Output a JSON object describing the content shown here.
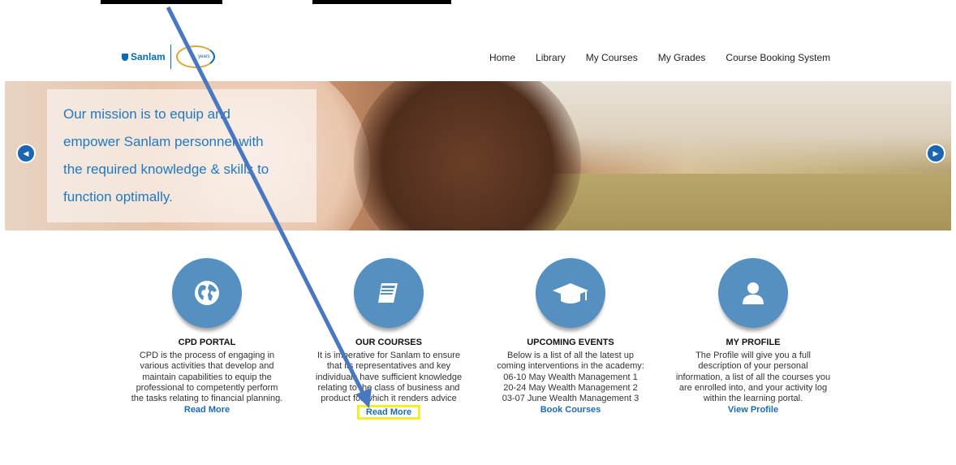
{
  "brand": {
    "name": "Sanlam",
    "badge": "years"
  },
  "nav": [
    "Home",
    "Library",
    "My Courses",
    "My Grades",
    "Course Booking System"
  ],
  "hero": {
    "mission_lines": [
      "Our mission is to equip and",
      "empower Sanlam personnel with",
      "the required knowledge & skills to",
      "function optimally."
    ]
  },
  "features": [
    {
      "title": "CPD PORTAL",
      "icon": "globe-icon",
      "lines": [
        "CPD is the process of engaging in",
        "various activities that develop and",
        "maintain capabilities to equip the",
        "professional to competently perform",
        "the tasks relating to financial planning."
      ],
      "link": "Read More"
    },
    {
      "title": "OUR COURSES",
      "icon": "book-icon",
      "lines": [
        "It is imperative for Sanlam to ensure",
        "that its representatives and key",
        "individuals have sufficient knowledge",
        "relating to the class of business and",
        "product for which it renders advice"
      ],
      "link": "Read More"
    },
    {
      "title": "UPCOMING EVENTS",
      "icon": "graduation-cap-icon",
      "lines": [
        "Below is a list of all the latest up",
        "coming interventions in the academy:",
        "06-10 May Wealth Management 1",
        "20-24 May Wealth Management 2",
        "03-07 June Wealth Management 3"
      ],
      "link": "Book Courses"
    },
    {
      "title": "MY PROFILE",
      "icon": "user-icon",
      "lines": [
        "The Profile will give you a full",
        "description of your personal",
        "information, a list of all the courses you",
        "are enrolled into, and your activity log",
        "within the learning portal."
      ],
      "link": "View Profile"
    }
  ],
  "colors": {
    "accent": "#5590c1",
    "link": "#1e6bb5",
    "highlight": "#f2ee2a",
    "annotation_arrow": "#4a78c0"
  }
}
